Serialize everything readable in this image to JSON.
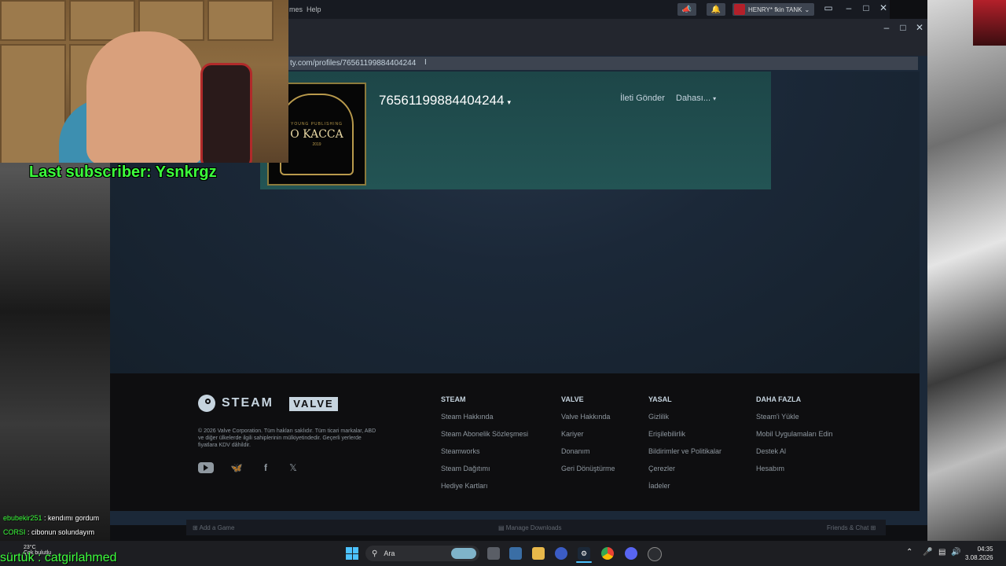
{
  "stream": {
    "last_subscriber": "Last subscriber: Ysnkrgz",
    "chat": [
      {
        "nick": "ebubekir251",
        "message": " : kendımı gordum"
      },
      {
        "nick": "CORSI",
        "message": " : cibonun solundayım"
      }
    ],
    "overlay_name": "sürtük : catgirlahmed"
  },
  "steam_client": {
    "menu_fragment": "mes",
    "menu_help": "Help",
    "account_name": "HENRY* fkin TANK",
    "bottom_bar": {
      "add_game": "Add a Game",
      "manage_downloads": "Manage Downloads",
      "friends_chat": "Friends & Chat"
    }
  },
  "browser": {
    "url": "ty.com/profiles/76561199884404244"
  },
  "profile": {
    "name": "76561199884404244",
    "send_message": "İleti Gönder",
    "more": "Dahası...",
    "avatar_top": "YOUNG PUBLISHING",
    "avatar_text": "O KACCA",
    "avatar_year": "2019"
  },
  "footer": {
    "steam_word": "STEAM",
    "valve_word": "VALVE",
    "copyright": "© 2026 Valve Corporation. Tüm hakları saklıdır. Tüm ticari markalar, ABD ve diğer ülkelerde ilgili sahiplerinin mülkiyetindedir. Geçerli yerlerde fiyatlara KDV dâhildir.",
    "columns": [
      {
        "heading": "STEAM",
        "links": [
          "Steam Hakkında",
          "Steam Abonelik Sözleşmesi",
          "Steamworks",
          "Steam Dağıtımı",
          "Hediye Kartları"
        ]
      },
      {
        "heading": "VALVE",
        "links": [
          "Valve Hakkında",
          "Kariyer",
          "Donanım",
          "Geri Dönüştürme"
        ]
      },
      {
        "heading": "YASAL",
        "links": [
          "Gizlilik",
          "Erişilebilirlik",
          "Bildirimler ve Politikalar",
          "Çerezler",
          "İadeler"
        ]
      },
      {
        "heading": "DAHA FAZLA",
        "links": [
          "Steam'i Yükle",
          "Mobil Uygulamaları Edin",
          "Destek Al",
          "Hesabım"
        ]
      }
    ]
  },
  "taskbar": {
    "weather_temp": "23°C",
    "weather_text": "Çok bulutlu",
    "search_label": "Ara",
    "time": "04:35",
    "date": "3.08.2026"
  },
  "colors": {
    "steam_dark": "#171a21",
    "profile_bg": "#235454",
    "chat_green": "#3cff3c",
    "accent_blue": "#4cc2ff"
  }
}
